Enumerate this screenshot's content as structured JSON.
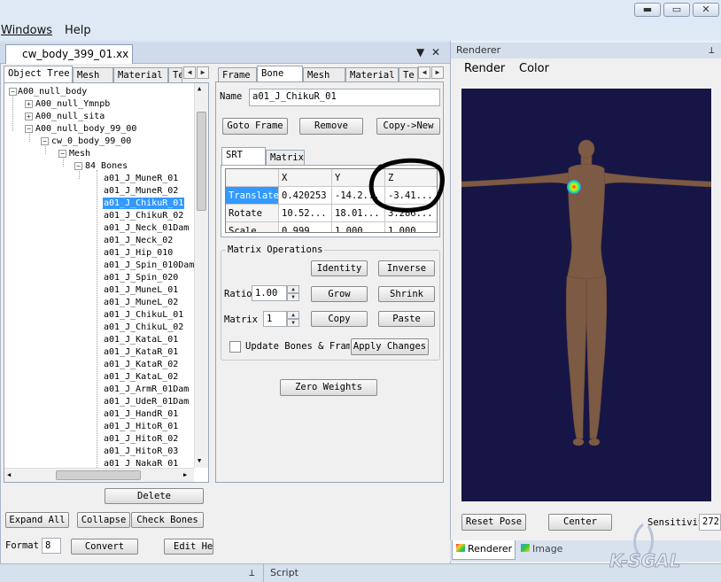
{
  "menu": {
    "windows": "Windows",
    "help": "Help"
  },
  "document": {
    "tab": "cw_body_399_01.xx"
  },
  "left_tabs": [
    "Object Tree",
    "Mesh",
    "Material",
    "Te"
  ],
  "tree": [
    {
      "label": "A00_null_body"
    },
    {
      "label": "A00_null_Ymnpb"
    },
    {
      "label": "A00_null_sita"
    },
    {
      "label": "A00_null_body_99_00"
    },
    {
      "label": "cw_0_body_99_00"
    },
    {
      "label": "Mesh"
    },
    {
      "label": "84 Bones"
    },
    {
      "label": "a01_J_MuneR_01"
    },
    {
      "label": "a01_J_MuneR_02"
    },
    {
      "label": "a01_J_ChikuR_01"
    },
    {
      "label": "a01_J_ChikuR_02"
    },
    {
      "label": "a01_J_Neck_01Dam"
    },
    {
      "label": "a01_J_Neck_02"
    },
    {
      "label": "a01_J_Hip_010"
    },
    {
      "label": "a01_J_Spin_010Dam"
    },
    {
      "label": "a01_J_Spin_020"
    },
    {
      "label": "a01_J_MuneL_01"
    },
    {
      "label": "a01_J_MuneL_02"
    },
    {
      "label": "a01_J_ChikuL_01"
    },
    {
      "label": "a01_J_ChikuL_02"
    },
    {
      "label": "a01_J_KataL_01"
    },
    {
      "label": "a01_J_KataR_01"
    },
    {
      "label": "a01_J_KataR_02"
    },
    {
      "label": "a01_J_KataL_02"
    },
    {
      "label": "a01_J_ArmR_01Dam"
    },
    {
      "label": "a01_J_UdeR_01Dam"
    },
    {
      "label": "a01_J_HandR_01"
    },
    {
      "label": "a01_J_HitoR_01"
    },
    {
      "label": "a01_J_HitoR_02"
    },
    {
      "label": "a01_J_HitoR_03"
    },
    {
      "label": "a01_J_NakaR_01"
    }
  ],
  "left_buttons": {
    "delete": "Delete",
    "expand_all": "Expand All",
    "collapse": "Collapse",
    "check_bones": "Check Bones",
    "format_label": "Format",
    "format_value": "8",
    "convert": "Convert",
    "edit_hex": "Edit He"
  },
  "prop_tabs": [
    "Frame",
    "Bone",
    "Mesh",
    "Material",
    "Te"
  ],
  "bone": {
    "name_label": "Name",
    "name_value": "a01_J_ChikuR_01",
    "goto_frame": "Goto Frame",
    "remove": "Remove",
    "copy_new": "Copy->New"
  },
  "srt_tabs": [
    "SRT",
    "Matrix"
  ],
  "srt_table": {
    "columns": [
      "",
      "X",
      "Y",
      "Z"
    ],
    "rows": [
      {
        "label": "Translate",
        "x": "0.420253",
        "y": "-14.2...",
        "z": "-3.41..."
      },
      {
        "label": "Rotate",
        "x": "10.52...",
        "y": "18.01...",
        "z": "3.286..."
      },
      {
        "label": "Scale",
        "x": "0.999",
        "y": "1.000",
        "z": "1.000"
      }
    ]
  },
  "matrix_ops": {
    "title": "Matrix Operations",
    "identity": "Identity",
    "inverse": "Inverse",
    "ratio_label": "Ratio",
    "ratio_value": "1.00",
    "grow": "Grow",
    "shrink": "Shrink",
    "matrix_label": "Matrix #",
    "matrix_value": "1",
    "copy": "Copy",
    "paste": "Paste",
    "update_bones": "Update Bones & Frame",
    "apply_changes": "Apply Changes"
  },
  "zero_weights": "Zero Weights",
  "renderer": {
    "title": "Renderer",
    "menu_render": "Render",
    "menu_color": "Color",
    "reset_pose": "Reset Pose",
    "center": "Center",
    "sensitivity_label": "Sensitivit",
    "sensitivity_value": "272",
    "tab_renderer": "Renderer",
    "tab_image": "Image"
  },
  "status": {
    "script": "Script"
  },
  "watermark": "K-SGAL",
  "colors": {
    "selection": "#3399ff",
    "viewport_bg": "#161546",
    "annotation": "#000000"
  }
}
